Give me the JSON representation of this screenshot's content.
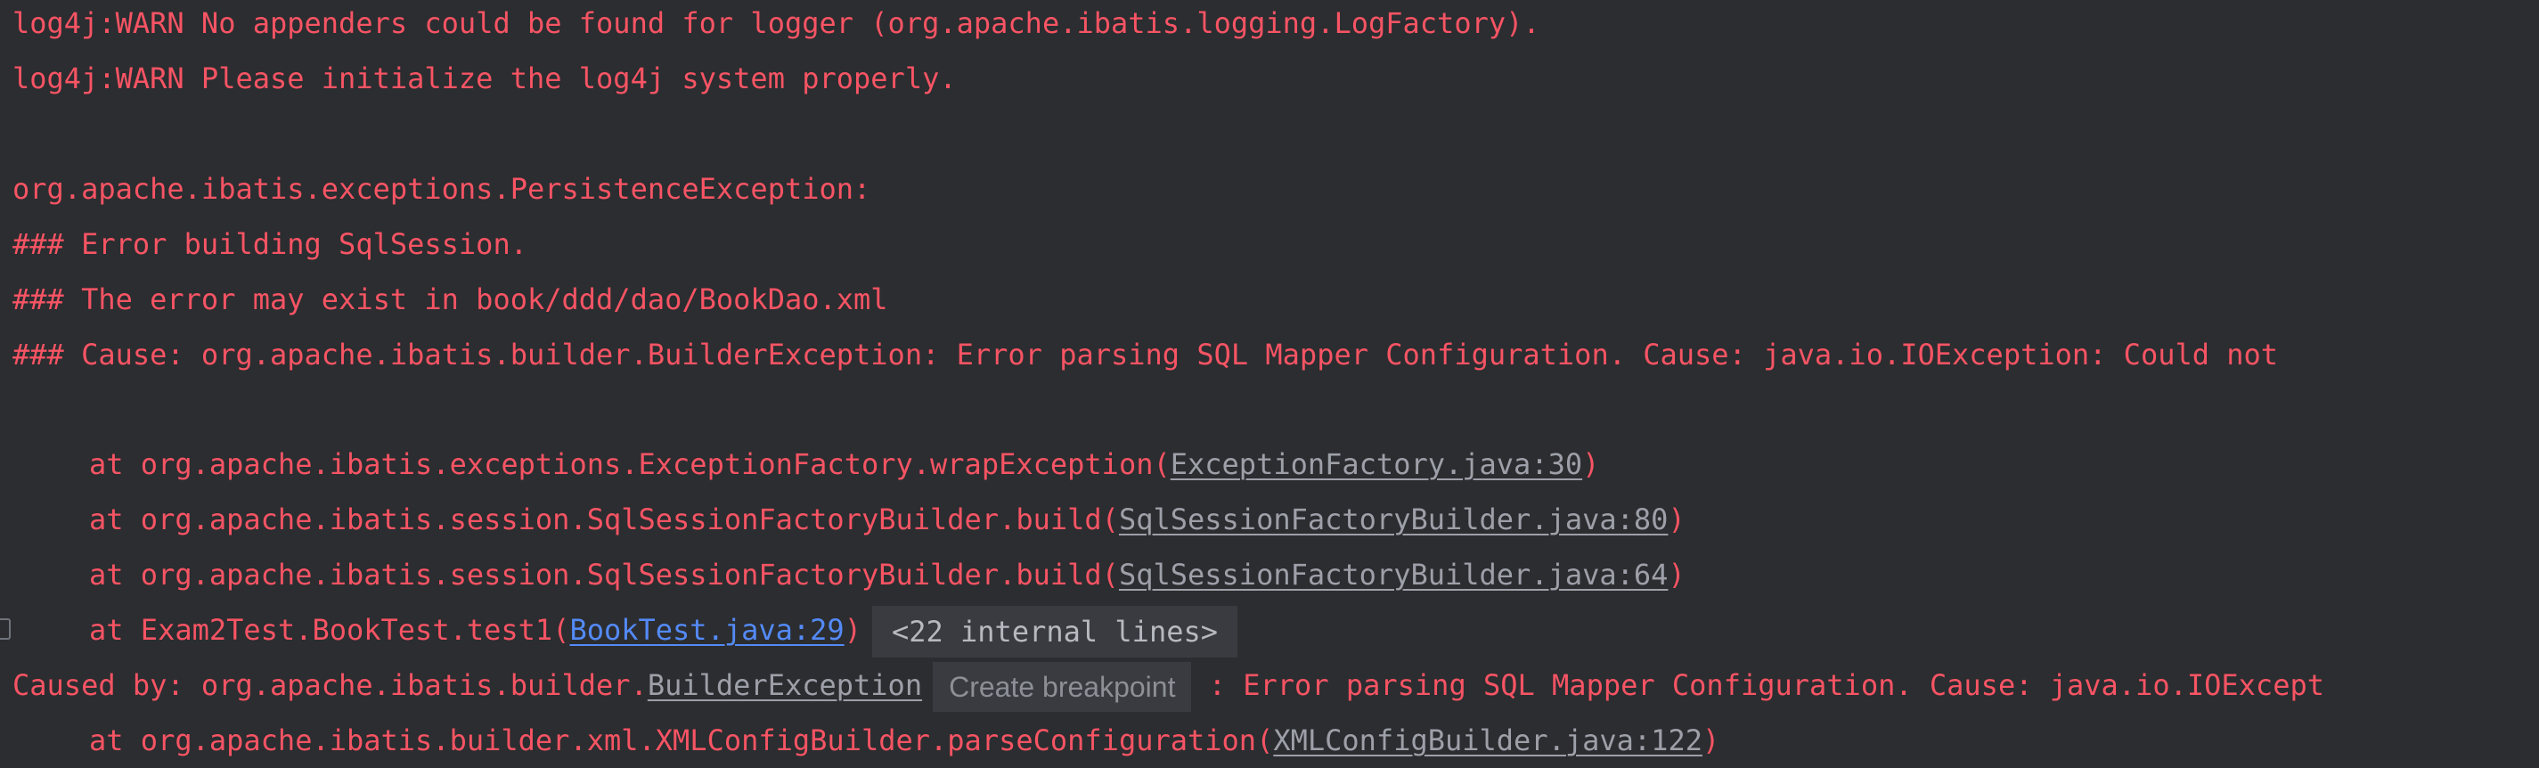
{
  "console": {
    "lines": {
      "l1": "log4j:WARN No appenders could be found for logger (org.apache.ibatis.logging.LogFactory).",
      "l2": "log4j:WARN Please initialize the log4j system properly.",
      "l3": "org.apache.ibatis.exceptions.PersistenceException:",
      "l4": "### Error building SqlSession.",
      "l5": "### The error may exist in book/ddd/dao/BookDao.xml",
      "l6": "### Cause: org.apache.ibatis.builder.BuilderException: Error parsing SQL Mapper Configuration. Cause: java.io.IOException: Could not"
    },
    "trace": {
      "f1_prefix": "at org.apache.ibatis.exceptions.ExceptionFactory.wrapException(",
      "f1_link": "ExceptionFactory.java:30",
      "f1_suffix": ")",
      "f2_prefix": "at org.apache.ibatis.session.SqlSessionFactoryBuilder.build(",
      "f2_link": "SqlSessionFactoryBuilder.java:80",
      "f2_suffix": ")",
      "f3_prefix": "at org.apache.ibatis.session.SqlSessionFactoryBuilder.build(",
      "f3_link": "SqlSessionFactoryBuilder.java:64",
      "f3_suffix": ")",
      "f4_prefix": "at Exam2Test.BookTest.test1(",
      "f4_link": "BookTest.java:29",
      "f4_suffix": ")",
      "f4_folded": "<22 internal lines>",
      "caused_prefix": "Caused by: org.apache.ibatis.builder.",
      "caused_link": "BuilderException",
      "caused_hint": "Create breakpoint",
      "caused_suffix": " : Error parsing SQL Mapper Configuration. Cause: java.io.IOExcept",
      "f5_prefix": "at org.apache.ibatis.builder.xml.XMLConfigBuilder.parseConfiguration(",
      "f5_link": "XMLConfigBuilder.java:122",
      "f5_suffix": ")"
    }
  },
  "colors": {
    "background": "#2b2d30",
    "error_text": "#f75464",
    "link_gray": "#9da0a8",
    "link_blue": "#548af7"
  }
}
